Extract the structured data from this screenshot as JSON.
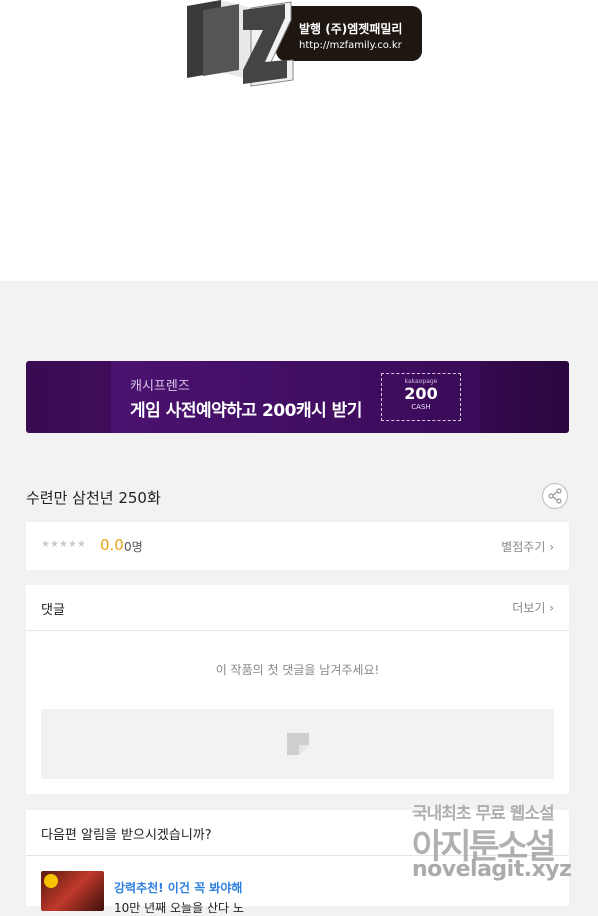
{
  "publisher": {
    "label": "발행 (주)엠젯패밀리",
    "url": "http://mzfamily.co.kr",
    "logo_text": "MZ"
  },
  "banner": {
    "small": "캐시프렌즈",
    "big": "게임 사전예약하고 200캐시 받기",
    "ticket_top": "kakaopage",
    "ticket_amount": "200",
    "ticket_unit": "CASH"
  },
  "episode": {
    "title": "수련만 삼천년 250화"
  },
  "rating": {
    "stars": "★★★★★",
    "score": "0.0",
    "count": "0명",
    "action": "별점주기 ›"
  },
  "comments": {
    "title": "댓글",
    "more": "더보기 ›",
    "empty": "이 작품의 첫 댓글을 남겨주세요!"
  },
  "notify": {
    "question": "다음편 알림을 받으시겠습니까?",
    "recommend": "강력추천! 이건 꼭 봐야해",
    "item_text": "10만 년째 오늘을 산다 노"
  },
  "watermark": {
    "line1": "국내최초 무료 웹소설",
    "line2": "아지툰소설",
    "line3": "novelagit.xyz"
  },
  "colors": {
    "banner_bg": "#3a0a52",
    "score": "#e8a313",
    "recommend": "#2d7fe0"
  }
}
